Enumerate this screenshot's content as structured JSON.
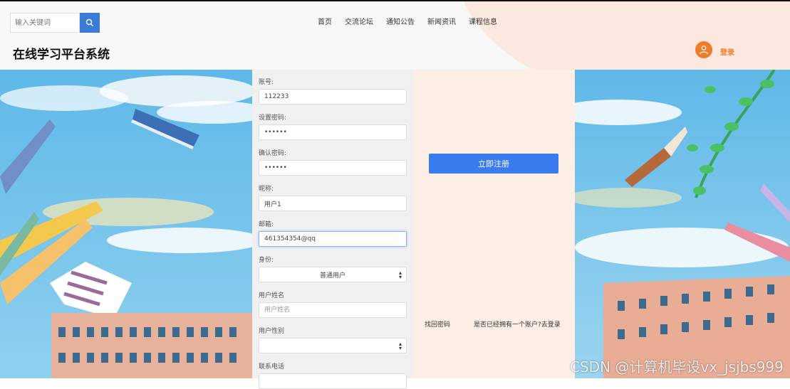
{
  "header": {
    "search_placeholder": "输入关键词",
    "nav": [
      "首页",
      "交流论坛",
      "通知公告",
      "新闻资讯",
      "课程信息"
    ],
    "site_title": "在线学习平台系统",
    "login_label": "登录"
  },
  "form": {
    "account_label": "账号:",
    "account_value": "112233",
    "password_label": "设置密码:",
    "password_value": "••••••",
    "confirm_label": "确认密码:",
    "confirm_value": "••••••",
    "nickname_label": "昵称:",
    "nickname_value": "用户1",
    "email_label": "邮箱:",
    "email_value": "461354354@qq",
    "identity_label": "身份:",
    "identity_value": "普通用户",
    "realname_label": "用户姓名",
    "realname_placeholder": "用户姓名",
    "gender_label": "用户性别",
    "gender_value": "",
    "phone_label": "联系电话"
  },
  "side": {
    "register_button": "立即注册",
    "forgot_password": "找回密码",
    "goto_login": "是否已经拥有一个账户?去登录"
  },
  "watermark": "CSDN @计算机毕设vx_jsjbs999",
  "colors": {
    "primary": "#3a7bf0",
    "accent": "#f07d2a",
    "side_bg": "#fdeee6"
  }
}
